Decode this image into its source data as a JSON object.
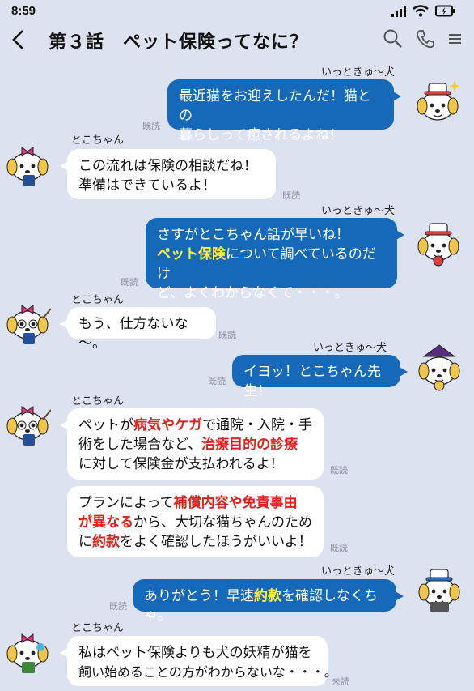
{
  "status": {
    "time": "8:59"
  },
  "header": {
    "title": "第３話　ペット保険ってなに？"
  },
  "messages": [
    {
      "side": "right",
      "name": "いっときゅ～犬",
      "read": "既読",
      "lines": [
        [
          "最近猫をお迎えしたんだ！猫との"
        ],
        [
          "暮らしって癒されるよね！"
        ]
      ]
    },
    {
      "side": "left",
      "name": "とこちゃん",
      "read": "既読",
      "lines": [
        [
          "この流れは保険の相談だね！"
        ],
        [
          "準備はできているよ！"
        ]
      ]
    },
    {
      "side": "right",
      "name": "いっときゅ～犬",
      "read": "既読",
      "line1": "さすがとこちゃん話が早いね！",
      "line2_hl": "ペット保険",
      "line2_rest": "について調べているのだけ",
      "line3": "ど、よくわからなくて・・・。"
    },
    {
      "side": "left",
      "name": "とこちゃん",
      "read": "既読",
      "text": "もう、仕方ないな～。"
    },
    {
      "side": "right",
      "name": "いっときゅ～犬",
      "read": "既読",
      "text": "イヨッ！とこちゃん先生！"
    },
    {
      "side": "left",
      "name": "とこちゃん",
      "read": "既読",
      "l1a": "ペットが",
      "l1b": "病気やケガ",
      "l1c": "で通院・入院・手",
      "l2a": "術をした場合など、",
      "l2b": "治療目的の診療",
      "l3": "に対して保険金が支払われるよ！"
    },
    {
      "side": "left",
      "read": "既読",
      "l1a": "プランによって",
      "l1b": "補償内容や免責事由",
      "l2a": "が異なる",
      "l2b": "から、大切な猫ちゃんのため",
      "l3a": "に",
      "l3b": "約款",
      "l3c": "をよく確認したほうがいいよ！"
    },
    {
      "side": "right",
      "name": "いっときゅ～犬",
      "read": "既読",
      "a": "ありがとう！早速",
      "b": "約款",
      "c": "を確認しなくちゃ。"
    },
    {
      "side": "left",
      "name": "とこちゃん",
      "read": "未読",
      "lines": [
        [
          "私はペット保険よりも犬の妖精が猫を"
        ],
        [
          "飼い始めることの方がわからないな・・・。"
        ]
      ]
    }
  ],
  "colors": {
    "background": "#dde2f1",
    "right_bubble": "#1569b8",
    "highlight_yellow": "#ffee3a",
    "highlight_red": "#e0221c"
  },
  "icons": [
    "back-chevron",
    "search",
    "phone",
    "menu",
    "signal",
    "wifi",
    "battery-charging"
  ]
}
